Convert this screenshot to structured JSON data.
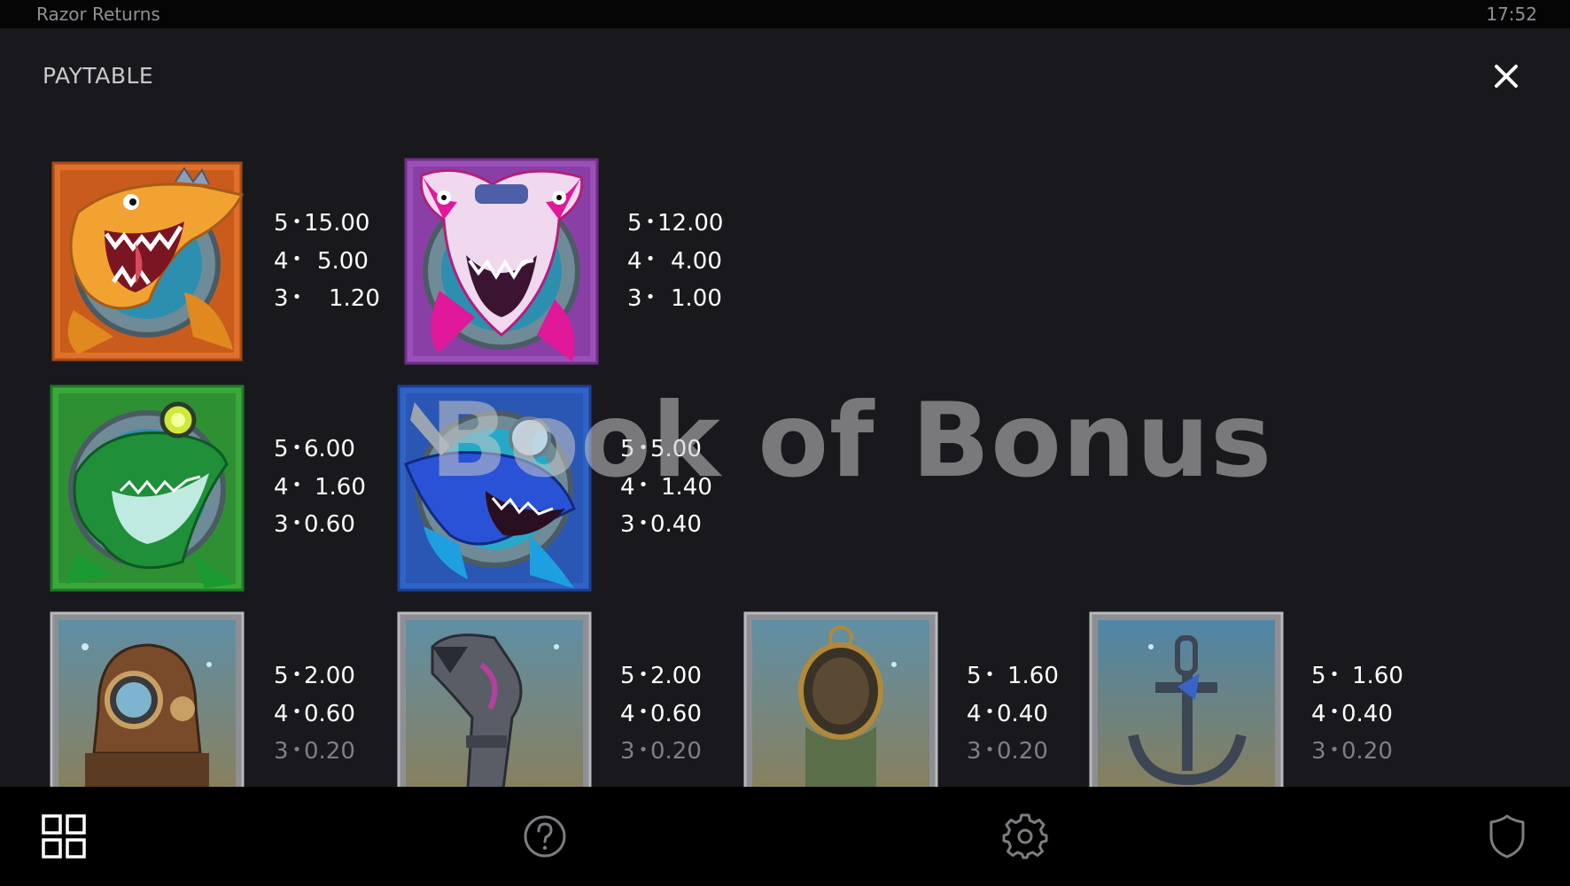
{
  "window": {
    "title": "Razor Returns",
    "clock": "17:52"
  },
  "panel": {
    "title": "PAYTABLE"
  },
  "watermark": "Book of Bonus",
  "symbols": [
    {
      "name": "orange shark",
      "payouts": [
        {
          "count": "5",
          "amount": "15.00"
        },
        {
          "count": "4",
          "amount": "5.00"
        },
        {
          "count": "3",
          "amount": "1.20"
        }
      ]
    },
    {
      "name": "pink hammerhead",
      "payouts": [
        {
          "count": "5",
          "amount": "12.00"
        },
        {
          "count": "4",
          "amount": "4.00"
        },
        {
          "count": "3",
          "amount": "1.00"
        }
      ]
    },
    {
      "name": "green shark",
      "payouts": [
        {
          "count": "5",
          "amount": "6.00"
        },
        {
          "count": "4",
          "amount": "1.60"
        },
        {
          "count": "3",
          "amount": "0.60"
        }
      ]
    },
    {
      "name": "blue sawshark",
      "payouts": [
        {
          "count": "5",
          "amount": "5.00"
        },
        {
          "count": "4",
          "amount": "1.40"
        },
        {
          "count": "3",
          "amount": "0.40"
        }
      ]
    },
    {
      "name": "diving helmet",
      "payouts": [
        {
          "count": "5",
          "amount": "2.00"
        },
        {
          "count": "4",
          "amount": "0.60"
        },
        {
          "count": "3",
          "amount": "0.20"
        }
      ]
    },
    {
      "name": "periscope",
      "payouts": [
        {
          "count": "5",
          "amount": "2.00"
        },
        {
          "count": "4",
          "amount": "0.60"
        },
        {
          "count": "3",
          "amount": "0.20"
        }
      ]
    },
    {
      "name": "compass",
      "payouts": [
        {
          "count": "5",
          "amount": "1.60"
        },
        {
          "count": "4",
          "amount": "0.40"
        },
        {
          "count": "3",
          "amount": "0.20"
        }
      ]
    },
    {
      "name": "anchor",
      "payouts": [
        {
          "count": "5",
          "amount": "1.60"
        },
        {
          "count": "4",
          "amount": "0.40"
        },
        {
          "count": "3",
          "amount": "0.20"
        }
      ]
    }
  ],
  "toolbar": {
    "icons": [
      "grid-icon",
      "help-icon",
      "settings-icon",
      "shield-icon"
    ]
  },
  "colors": {
    "background": "#19191d",
    "bars": "#000000",
    "text": "#ffffff",
    "muted": "#7f7f84",
    "orange_tile": "#e0702a",
    "purple_tile": "#9b4fb8",
    "green_tile": "#3aa83a",
    "blue_tile": "#2f63c8",
    "metal_tile": "#8d8f94"
  }
}
